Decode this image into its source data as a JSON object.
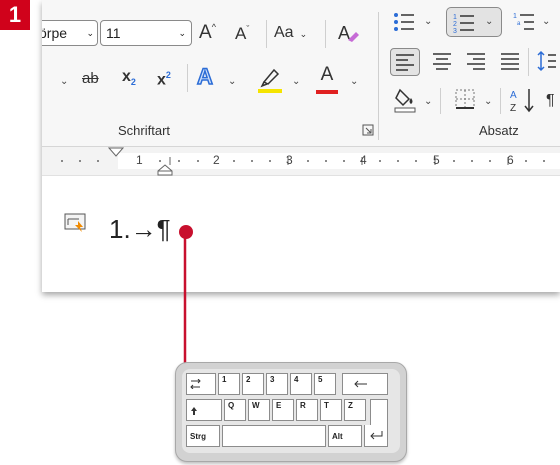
{
  "step": {
    "number": "1"
  },
  "ribbon": {
    "font_name": "örpe",
    "font_size": "11",
    "grow_font": "A",
    "shrink_font": "A",
    "change_case": "Aa",
    "subscript": "x",
    "subscript_mark": "2",
    "superscript": "x",
    "superscript_mark": "2",
    "strikethrough": "ab",
    "text_effects": "A",
    "font_color": "A",
    "group_font": "Schriftart",
    "group_paragraph": "Absatz"
  },
  "ruler": {
    "numbers": [
      "1",
      "2",
      "3",
      "4",
      "5",
      "6"
    ]
  },
  "document": {
    "line_text": "1.→¶"
  },
  "keyboard": {
    "row1": [
      "1",
      "2",
      "3",
      "4",
      "5"
    ],
    "row2": [
      "Q",
      "W",
      "E",
      "R",
      "T",
      "Z"
    ],
    "ctrl": "Strg",
    "alt": "Alt"
  },
  "colors": {
    "marker": "#c8102e",
    "highlight": "#f5e400",
    "font_color_bar": "#e02020",
    "text_effect_blue": "#2b6cd6",
    "step_badge": "#d0021b"
  },
  "icons": [
    "tab-key-icon",
    "shift-arrow-icon",
    "backspace-arrow-icon",
    "enter-key-icon",
    "autoformat-options-icon",
    "bullets-icon",
    "numbering-icon",
    "multilevel-list-icon",
    "align-left-icon",
    "align-center-icon",
    "align-right-icon",
    "justify-icon",
    "shading-icon",
    "borders-icon",
    "sort-icon",
    "clear-formatting-icon",
    "dialog-launcher-icon"
  ]
}
